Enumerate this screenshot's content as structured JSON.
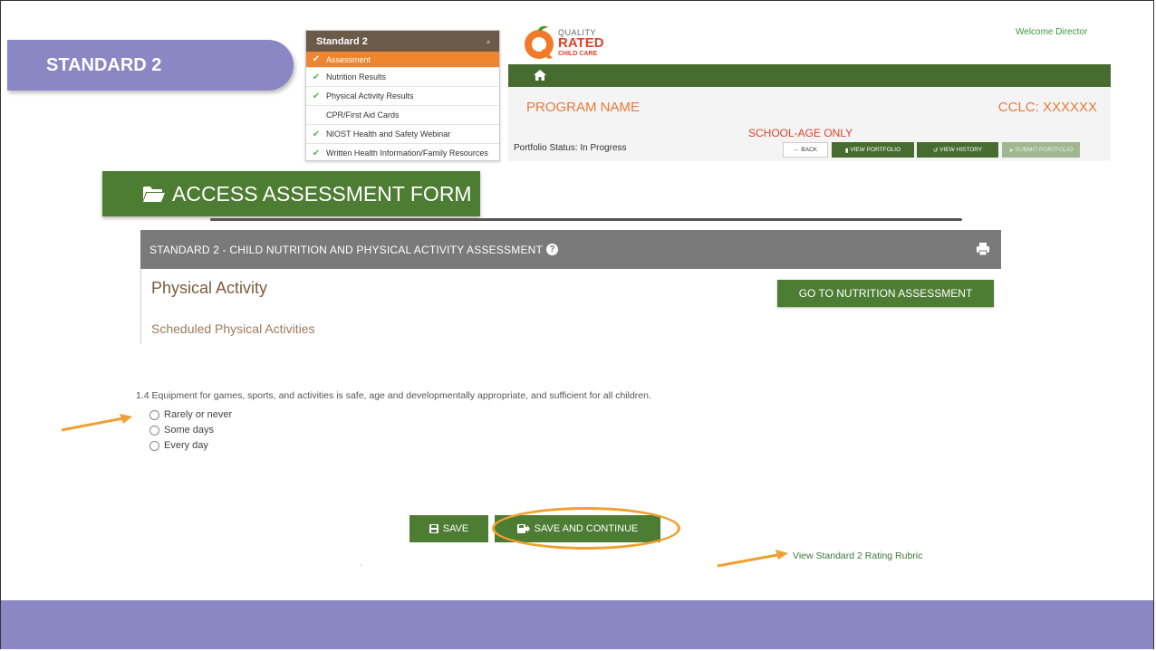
{
  "slide": {
    "banner_title": "STANDARD 2"
  },
  "standard_menu": {
    "header": "Standard 2",
    "items": [
      {
        "label": "Assessment",
        "checked": true,
        "active": true
      },
      {
        "label": "Nutrition Results",
        "checked": true,
        "active": false
      },
      {
        "label": "Physical Activity Results",
        "checked": true,
        "active": false
      },
      {
        "label": "CPR/First Aid Cards",
        "checked": false,
        "active": false
      },
      {
        "label": "NIOST Health and Safety Webinar",
        "checked": true,
        "active": false
      },
      {
        "label": "Written Health Information/Family Resources",
        "checked": true,
        "active": false
      }
    ]
  },
  "logo": {
    "line1": "QUALITY",
    "line2": "RATED",
    "line3": "CHILD CARE"
  },
  "header": {
    "welcome": "Welcome Director",
    "program_name": "PROGRAM NAME",
    "cclc": "CCLC: XXXXXX",
    "school_age": "SCHOOL-AGE ONLY",
    "portfolio_status": "Portfolio Status: In Progress",
    "buttons": {
      "back": "BACK",
      "view_portfolio": "VIEW PORTFOLIO",
      "view_history": "VIEW HISTORY",
      "submit_portfolio": "SUBMIT PORTFOLIO"
    }
  },
  "access_button": "ACCESS ASSESSMENT FORM",
  "assessment": {
    "header_title": "STANDARD 2 - CHILD NUTRITION AND PHYSICAL ACTIVITY ASSESSMENT",
    "section_title": "Physical Activity",
    "subsection": "Scheduled Physical Activities",
    "go_button": "GO TO NUTRITION ASSESSMENT",
    "question": "1.4 Equipment for games, sports, and activities is safe, age and developmentally appropriate, and sufficient for all children.",
    "options": [
      "Rarely or never",
      "Some days",
      "Every day"
    ],
    "save": "SAVE",
    "save_continue": "SAVE AND CONTINUE",
    "rubric_link": "View Standard 2 Rating Rubric"
  },
  "colors": {
    "accent_purple": "#8b86c4",
    "green": "#4d7c33",
    "orange": "#f08530",
    "arrow": "#f0a030"
  }
}
